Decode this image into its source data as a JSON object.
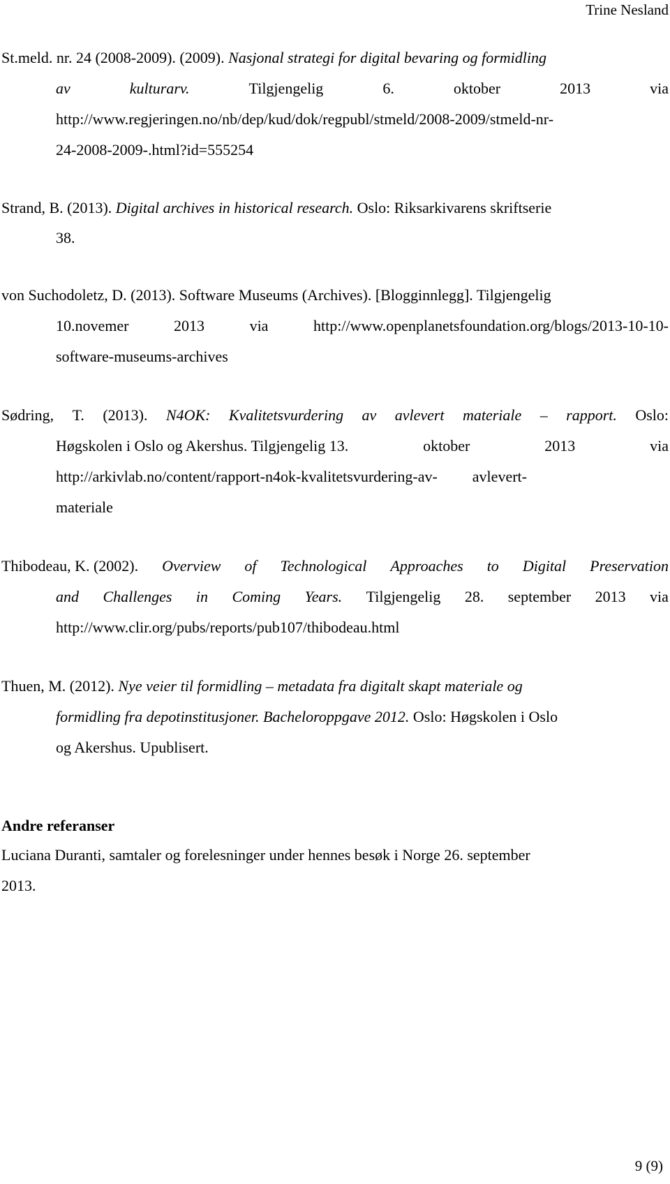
{
  "header": {
    "author": "Trine Nesland"
  },
  "references": [
    {
      "id": "stmeld",
      "l1_plain": "St.meld. nr. 24 (2008-2009). (2009). ",
      "l1_italic": "Nasjonal strategi for digital bevaring og formidling",
      "l2_words": [
        "av",
        "kulturarv.",
        "Tilgjengelig",
        "6.",
        "oktober",
        "2013",
        "via"
      ],
      "l3": "http://www.regjeringen.no/nb/dep/kud/dok/regpubl/stmeld/2008-2009/stmeld-nr-",
      "l4": "24-2008-2009-.html?id=555254"
    },
    {
      "id": "strand",
      "l1_plain": "Strand, B. (2013). ",
      "l1_italic": "Digital archives in historical research.",
      "l1_rest": " Oslo: Riksarkivarens skriftserie",
      "l2": "38."
    },
    {
      "id": "suchodoletz",
      "l1": "von Suchodoletz, D. (2013). Software Museums (Archives). [Blogginnlegg]. Tilgjengelig",
      "l2_words": [
        "10.novemer",
        "2013",
        "via",
        "http://www.openplanetsfoundation.org/blogs/2013-10-10-"
      ],
      "l3": "software-museums-archives"
    },
    {
      "id": "sodring",
      "l1_words": [
        "Sødring,",
        "T.",
        "(2013).",
        "N4OK:",
        "Kvalitetsvurdering",
        "av",
        "avlevert",
        "materiale",
        "–",
        "rapport.",
        "Oslo:"
      ],
      "l1_italic_from": 3,
      "l1_italic_to": 9,
      "l2_words": [
        "Høgskolen i Oslo og Akershus. Tilgjengelig 13.",
        "oktober",
        "2013",
        "via"
      ],
      "l3_a": "http://arkivlab.no/content/rapport-n4ok-kvalitetsvurdering-av-",
      "l3_b": "avlevert-",
      "l4": "materiale"
    },
    {
      "id": "thibodeau",
      "l1_plain": "Thibodeau, K. (2002). ",
      "l1_italic_words": [
        "Overview",
        "of",
        "Technological",
        "Approaches",
        "to",
        "Digital",
        "Preservation"
      ],
      "l2_italic_words": [
        "and",
        "Challenges",
        "in",
        "Coming",
        "Years."
      ],
      "l2_plain_words": [
        "Tilgjengelig",
        "28.",
        "september",
        "2013",
        "via"
      ],
      "l3": "http://www.clir.org/pubs/reports/pub107/thibodeau.html"
    },
    {
      "id": "thuen",
      "l1_plain": "Thuen, M. (2012). ",
      "l1_italic": "Nye veier til formidling – metadata fra digitalt skapt materiale og",
      "l2_italic": "formidling fra depotinstitusjoner. Bacheloroppgave 2012.",
      "l2_rest": " Oslo: Høgskolen i Oslo",
      "l3": "og Akershus. Upublisert."
    }
  ],
  "other": {
    "heading": "Andre referanser",
    "l1": "Luciana Duranti, samtaler og forelesninger under hennes besøk i Norge 26. september",
    "l2": "2013."
  },
  "footer": {
    "page_number": "9 (9)"
  }
}
